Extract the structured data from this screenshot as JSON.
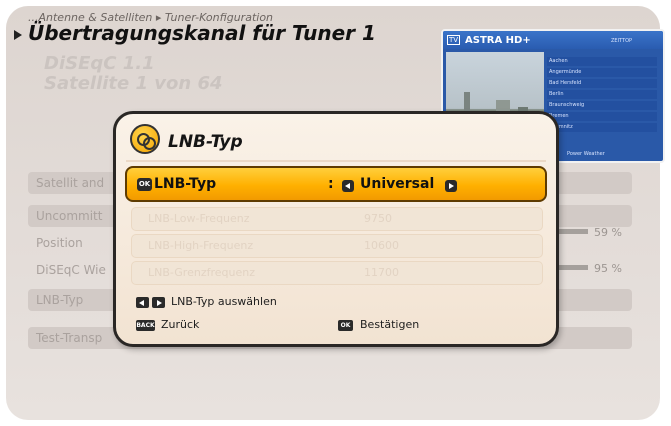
{
  "breadcrumb": "...Antenne & Satelliten ▸ Tuner-Konfiguration",
  "page_title": "Übertragungskanal für Tuner 1",
  "subtitle_1": "DiSEqC 1.1",
  "subtitle_2": "Satellite 1 von 64",
  "preview": {
    "channel": "ASTRA HD+",
    "tv_badge": "TV",
    "header_text": "ZEITTOP",
    "rows": [
      "Aachen",
      "Angermünde",
      "Bad Hersfeld",
      "Berlin",
      "Braunschweig",
      "Bremen",
      "Chemnitz"
    ],
    "footer_text": "Power Weather"
  },
  "background_list": {
    "rows": [
      {
        "label": "Satellit and"
      },
      {
        "label": "Uncommitt"
      },
      {
        "label": "Position",
        "pct": "59 %"
      },
      {
        "label": "DiSEqC Wie",
        "pct": "95 %"
      },
      {
        "label": "LNB-Typ"
      },
      {
        "label": "Test-Transp"
      }
    ]
  },
  "dialog": {
    "title": "LNB-Typ",
    "selected_row": {
      "ok_key": "OK",
      "label": "LNB-Typ",
      "separator": ":",
      "value": "Universal"
    },
    "rows": [
      {
        "label": "LNB-Low-Frequenz",
        "value": "9750"
      },
      {
        "label": "LNB-High-Frequenz",
        "value": "10600"
      },
      {
        "label": "LNB-Grenzfrequenz",
        "value": "11700"
      }
    ],
    "help": {
      "select_text": "LNB-Typ auswählen",
      "back_key": "BACK",
      "back_text": "Zurück",
      "ok_key": "OK",
      "confirm_text": "Bestätigen"
    }
  }
}
